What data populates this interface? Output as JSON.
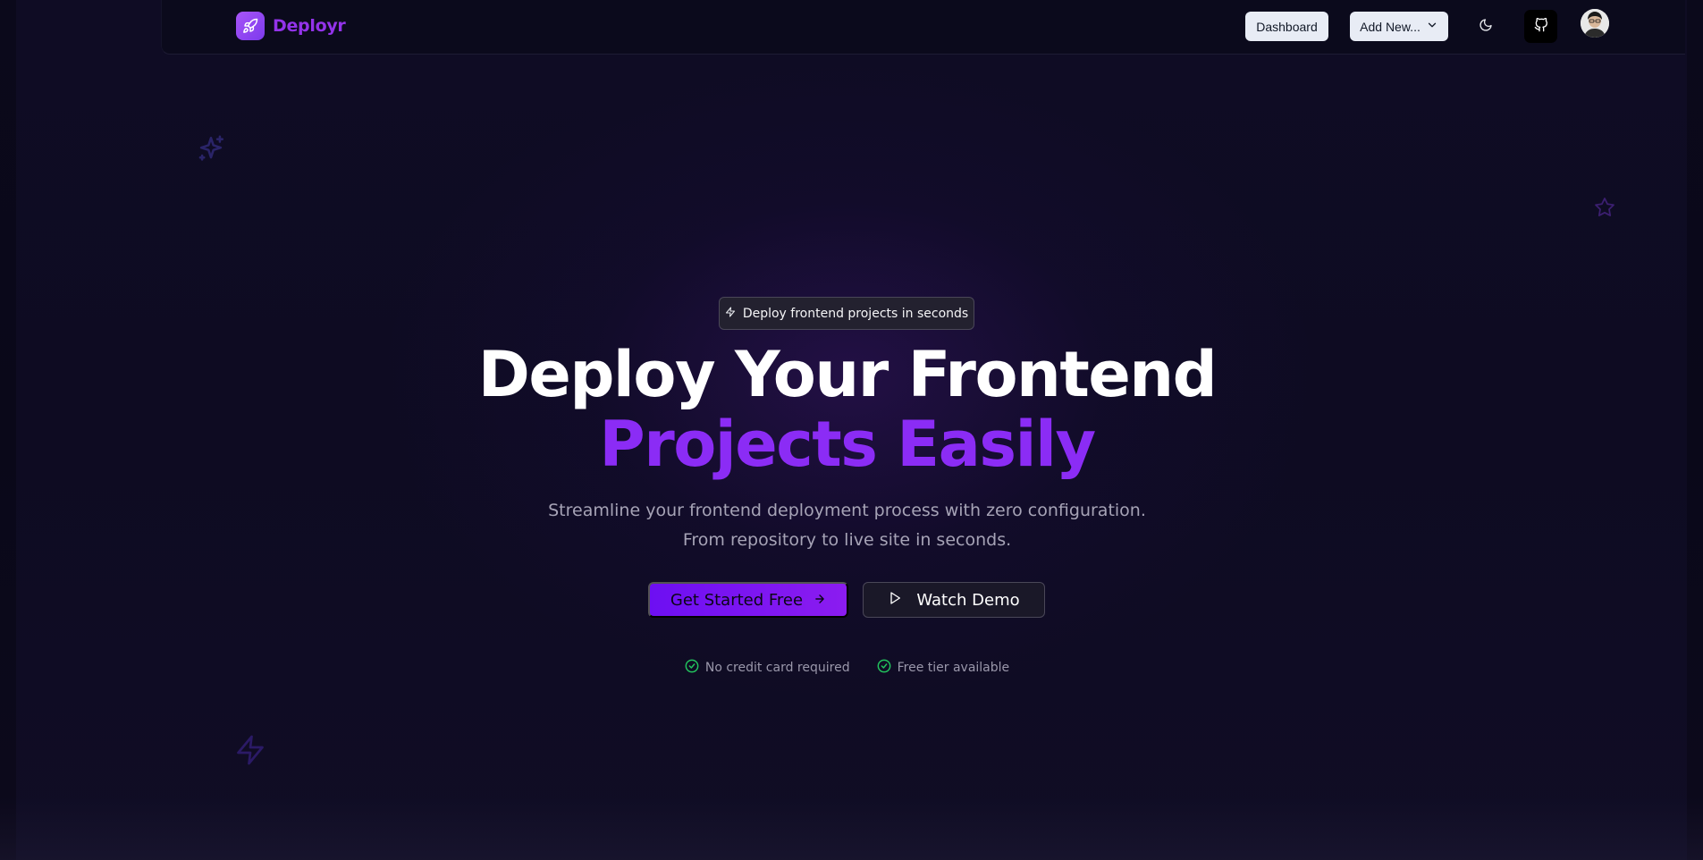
{
  "brand": {
    "name": "Deployr",
    "logo_icon": "rocket-icon",
    "accent": "#9333ea"
  },
  "nav": {
    "dashboard_label": "Dashboard",
    "add_new_label": "Add New...",
    "add_new_icon": "chevron-down-icon",
    "theme_icon": "moon-icon",
    "github_icon": "github-icon",
    "avatar_icon": "user-avatar"
  },
  "hero": {
    "badge_text": "Deploy frontend projects in seconds",
    "badge_icon": "zap-icon",
    "title_line1": "Deploy Your Frontend",
    "title_line2": "Projects Easily",
    "subtitle_line1": "Streamline your frontend deployment process with zero configuration.",
    "subtitle_line2": "From repository to live site in seconds.",
    "primary_cta": "Get Started Free",
    "primary_cta_icon": "arrow-right-icon",
    "secondary_cta": "Watch Demo",
    "secondary_cta_icon": "play-icon",
    "perks": [
      {
        "label": "No credit card required",
        "icon": "check-circle-icon"
      },
      {
        "label": "Free tier available",
        "icon": "check-circle-icon"
      }
    ]
  },
  "decorations": {
    "icons": [
      "sparkles-icon",
      "star-icon",
      "zap-icon"
    ]
  },
  "colors": {
    "background": "#0d0b1f",
    "primary_gradient_start": "#6d0ff2",
    "primary_gradient_end": "#8b1cf0",
    "title_accent": "#8b2cf5",
    "success": "#22c55e"
  }
}
